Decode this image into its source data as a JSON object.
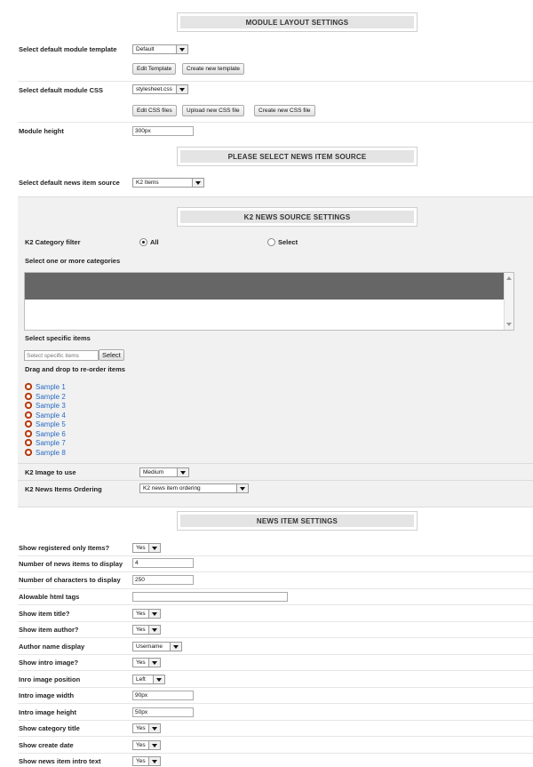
{
  "module_layout": {
    "header": "MODULE LAYOUT SETTINGS",
    "template_label": "Select default module template",
    "template_value": "Default",
    "edit_template_btn": "Edit Template",
    "create_template_btn": "Create new template",
    "css_label": "Select default module CSS",
    "css_value": "stylesheet.css",
    "edit_css_btn": "Edit CSS files",
    "upload_css_btn": "Upload new CSS file",
    "create_css_btn": "Create new CSS file",
    "height_label": "Module height",
    "height_value": "300px"
  },
  "source": {
    "header": "PLEASE SELECT NEWS ITEM SOURCE",
    "label": "Select default news item source",
    "value": "K2 Items"
  },
  "k2": {
    "header": "K2 NEWS SOURCE SETTINGS",
    "filter_label": "K2 Category filter",
    "filter_all": "All",
    "filter_select": "Select",
    "categories_label": "Select one or more categories",
    "specific_label": "Select specific items",
    "specific_placeholder": "Select specific items",
    "specific_btn": "Select",
    "reorder_label": "Drag and drop to re-order items",
    "items": [
      "Sample 1",
      "Sample 2",
      "Sample 3",
      "Sample 4",
      "Sample 5",
      "Sample 6",
      "Sample 7",
      "Sample 8"
    ],
    "image_label": "K2 Image to use",
    "image_value": "Medium",
    "ordering_label": "K2 News Items Ordering",
    "ordering_value": "K2 news item ordering"
  },
  "news": {
    "header": "NEWS ITEM SETTINGS",
    "rows": [
      {
        "label": "Show registered only Items?",
        "value": "Yes"
      },
      {
        "label": "Number of news items to display",
        "value": "4"
      },
      {
        "label": "Number of characters to display",
        "value": "250"
      },
      {
        "label": "Alowable html tags",
        "value": ""
      },
      {
        "label": "Show item title?",
        "value": "Yes"
      },
      {
        "label": "Show item author?",
        "value": "Yes"
      },
      {
        "label": "Author name display",
        "value": "Username"
      },
      {
        "label": "Show intro image?",
        "value": "Yes"
      },
      {
        "label": "Inro image position",
        "value": "Left"
      },
      {
        "label": "Intro image width",
        "value": "90px"
      },
      {
        "label": "Intro image height",
        "value": "50px"
      },
      {
        "label": "Show category title",
        "value": "Yes"
      },
      {
        "label": "Show create date",
        "value": "Yes"
      },
      {
        "label": "Show news item intro text",
        "value": "Yes"
      }
    ]
  }
}
